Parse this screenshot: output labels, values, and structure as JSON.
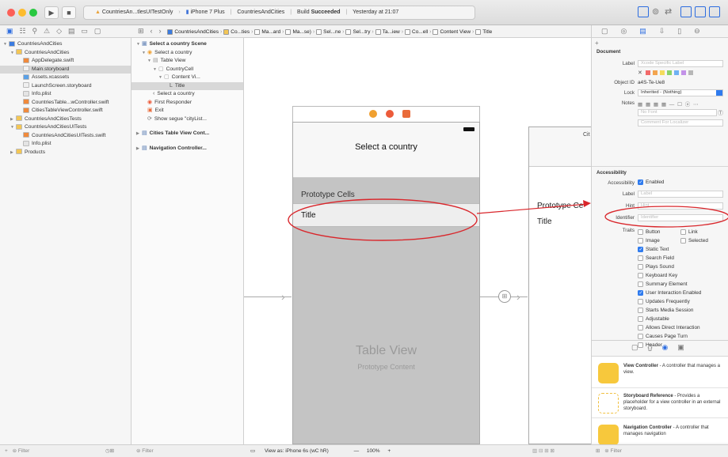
{
  "toolbar": {
    "scheme": "CountriesAn...tlesUITestOnly",
    "device": "iPhone 7 Plus",
    "project": "CountriesAndCities",
    "build_label": "Build",
    "build_status": "Succeeded",
    "time": "Yesterday at 21:07"
  },
  "breadcrumb": [
    "CountriesAndCities",
    "Co...ties",
    "Ma...ard",
    "Ma...se)",
    "Sel...ne",
    "Sel...try",
    "Ta...iew",
    "Co...ell",
    "Content View",
    "Title"
  ],
  "navigator": {
    "items": [
      {
        "label": "CountriesAndCities",
        "indent": 0,
        "icon": "project"
      },
      {
        "label": "CountriesAndCities",
        "indent": 1,
        "icon": "folder"
      },
      {
        "label": "AppDelegate.swift",
        "indent": 2,
        "icon": "swift"
      },
      {
        "label": "Main.storyboard",
        "indent": 2,
        "icon": "storyboard"
      },
      {
        "label": "Assets.xcassets",
        "indent": 2,
        "icon": "assets"
      },
      {
        "label": "LaunchScreen.storyboard",
        "indent": 2,
        "icon": "storyboard"
      },
      {
        "label": "Info.plist",
        "indent": 2,
        "icon": "plist"
      },
      {
        "label": "CountriesTable...wController.swift",
        "indent": 2,
        "icon": "swift"
      },
      {
        "label": "CitiesTableViewController.swift",
        "indent": 2,
        "icon": "swift"
      },
      {
        "label": "CountriesAndCitiesTests",
        "indent": 1,
        "icon": "folder"
      },
      {
        "label": "CountriesAndCitiesUITests",
        "indent": 1,
        "icon": "folder"
      },
      {
        "label": "CountriesAndCitiesUITests.swift",
        "indent": 2,
        "icon": "swift"
      },
      {
        "label": "Info.plist",
        "indent": 2,
        "icon": "plist"
      },
      {
        "label": "Products",
        "indent": 1,
        "icon": "folder"
      }
    ],
    "filter_placeholder": "Filter"
  },
  "outline": {
    "items": [
      {
        "label": "Select a country Scene",
        "indent": 0
      },
      {
        "label": "Select a country",
        "indent": 1
      },
      {
        "label": "Table View",
        "indent": 2
      },
      {
        "label": "CountryCell",
        "indent": 3
      },
      {
        "label": "Content Vi...",
        "indent": 4
      },
      {
        "label": "Title",
        "indent": 5
      },
      {
        "label": "Select a country",
        "indent": 2
      },
      {
        "label": "First Responder",
        "indent": 1
      },
      {
        "label": "Exit",
        "indent": 1
      },
      {
        "label": "Show segue \"cityList...",
        "indent": 1
      },
      {
        "label": "Cities Table View Cont...",
        "indent": 0
      },
      {
        "label": "Navigation Controller...",
        "indent": 0
      }
    ],
    "filter_placeholder": "Filter"
  },
  "canvas": {
    "nav_title": "Select a country",
    "prototype_cells": "Prototype Cells",
    "cell_title": "Title",
    "table_view": "Table View",
    "prototype_content": "Prototype Content",
    "second_header": "Prototype Ce",
    "second_title": "Title",
    "second_nav": "Cit"
  },
  "bottom_bar": {
    "view_as": "View as: iPhone 6s (wC hR)",
    "zoom": "100%"
  },
  "inspector": {
    "document_header": "Document",
    "label_label": "Label",
    "label_placeholder": "Xcode Specific Label",
    "object_id_label": "Object ID",
    "object_id": "a4S-Te-Ue8",
    "lock_label": "Lock",
    "lock_value": "Inherited - (Nothing)",
    "notes_label": "Notes",
    "font_placeholder": "No Font",
    "comment_placeholder": "Comment For Localizer",
    "accessibility_header": "Accessibility",
    "accessibility_label": "Accessibility",
    "enabled": "Enabled",
    "a_label": "Label",
    "a_label_ph": "Label",
    "hint": "Hint",
    "hint_ph": "Hint",
    "identifier": "Identifier",
    "identifier_ph": "Identifier",
    "traits": "Traits",
    "trait_items": [
      {
        "label": "Button",
        "on": false
      },
      {
        "label": "Link",
        "on": false
      },
      {
        "label": "Image",
        "on": false
      },
      {
        "label": "Selected",
        "on": false
      },
      {
        "label": "Static Text",
        "on": true
      },
      {
        "label": "Search Field",
        "on": false
      },
      {
        "label": "Plays Sound",
        "on": false
      },
      {
        "label": "Keyboard Key",
        "on": false
      },
      {
        "label": "Summary Element",
        "on": false
      },
      {
        "label": "User Interaction Enabled",
        "on": true
      },
      {
        "label": "Updates Frequently",
        "on": false
      },
      {
        "label": "Starts Media Session",
        "on": false
      },
      {
        "label": "Adjustable",
        "on": false
      },
      {
        "label": "Allows Direct Interaction",
        "on": false
      },
      {
        "label": "Causes Page Turn",
        "on": false
      },
      {
        "label": "Header",
        "on": false
      }
    ],
    "library": [
      {
        "title": "View Controller",
        "desc": " - A controller that manages a view."
      },
      {
        "title": "Storyboard Reference",
        "desc": " - Provides a placeholder for a view controller in an external storyboard."
      },
      {
        "title": "Navigation Controller",
        "desc": " - A controller that manages navigation"
      }
    ],
    "filter_placeholder": "Filter"
  },
  "colors": {
    "accent": "#2f7bee",
    "annotation": "#d9262b",
    "folder": "#f3c655",
    "cell_bg": "#c9c9c9"
  }
}
